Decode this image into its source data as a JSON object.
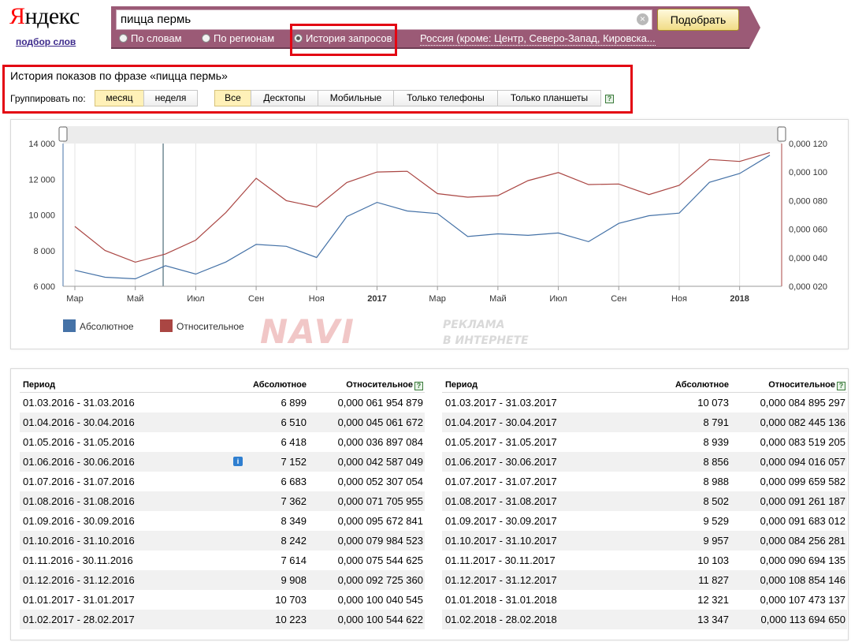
{
  "brand": {
    "logo_first": "Я",
    "logo_rest": "ндекс",
    "sublink": "подбор слов"
  },
  "search": {
    "value": "пицца пермь",
    "clear_glyph": "×",
    "submit_label": "Подобрать"
  },
  "modes": [
    {
      "label": "По словам",
      "selected": false
    },
    {
      "label": "По регионам",
      "selected": false
    },
    {
      "label": "История запросов",
      "selected": true
    }
  ],
  "region": "Россия (кроме: Центр, Северо-Запад, Кировска...",
  "history": {
    "title": "История показов по фразе «пицца пермь»",
    "group_label": "Группировать по:",
    "group_options": [
      {
        "label": "месяц",
        "active": true
      },
      {
        "label": "неделя",
        "active": false
      }
    ],
    "device_options": [
      {
        "label": "Все",
        "active": true
      },
      {
        "label": "Десктопы",
        "active": false
      },
      {
        "label": "Мобильные",
        "active": false
      },
      {
        "label": "Только телефоны",
        "active": false
      },
      {
        "label": "Только планшеты",
        "active": false
      }
    ],
    "help_glyph": "?"
  },
  "chart_data": {
    "type": "line",
    "x": [
      "2016-03",
      "2016-04",
      "2016-05",
      "2016-06",
      "2016-07",
      "2016-08",
      "2016-09",
      "2016-10",
      "2016-11",
      "2016-12",
      "2017-01",
      "2017-02",
      "2017-03",
      "2017-04",
      "2017-05",
      "2017-06",
      "2017-07",
      "2017-08",
      "2017-09",
      "2017-10",
      "2017-11",
      "2017-12",
      "2018-01",
      "2018-02"
    ],
    "x_tick_labels": [
      "Мар",
      "Май",
      "Июл",
      "Сен",
      "Ноя",
      "2017",
      "Мар",
      "Май",
      "Июл",
      "Сен",
      "Ноя",
      "2018"
    ],
    "series": [
      {
        "name": "Абсолютное",
        "axis": "left",
        "color": "#4572a7",
        "values": [
          6899,
          6510,
          6418,
          7152,
          6683,
          7362,
          8349,
          8242,
          7614,
          9908,
          10703,
          10223,
          10073,
          8791,
          8939,
          8856,
          8988,
          8502,
          9529,
          9957,
          10103,
          11827,
          12321,
          13347
        ]
      },
      {
        "name": "Относительное",
        "axis": "right",
        "color": "#aa4643",
        "values": [
          0.061954879,
          0.045061672,
          0.036897084,
          0.042587049,
          0.052307054,
          0.071705955,
          0.095672841,
          0.079984523,
          0.075544625,
          0.09272536,
          0.100040545,
          0.100544622,
          0.084895297,
          0.082445136,
          0.083519205,
          0.094016057,
          0.099659582,
          0.091261187,
          0.091683012,
          0.084256281,
          0.090694135,
          0.108854146,
          0.107473137,
          0.11369465
        ]
      }
    ],
    "y_left": {
      "ticks": [
        "6 000",
        "8 000",
        "10 000",
        "12 000",
        "14 000"
      ],
      "range": [
        6000,
        14000
      ]
    },
    "y_right": {
      "ticks": [
        "0,000 020",
        "0,000 040",
        "0,000 060",
        "0,000 080",
        "0,000 100",
        "0,000 120"
      ],
      "range": [
        0.02,
        0.12
      ]
    },
    "grid": true,
    "legend": "bottom-left"
  },
  "watermark": {
    "big": "NAVI",
    "line1": "РЕКЛАМА",
    "line2": "В ИНТЕРНЕТЕ"
  },
  "table": {
    "headers": {
      "period": "Период",
      "absolute": "Абсолютное",
      "relative": "Относительное"
    },
    "left": [
      {
        "period": "01.03.2016 - 31.03.2016",
        "abs": "6 899",
        "rel": "0,000 061 954 879"
      },
      {
        "period": "01.04.2016 - 30.04.2016",
        "abs": "6 510",
        "rel": "0,000 045 061 672"
      },
      {
        "period": "01.05.2016 - 31.05.2016",
        "abs": "6 418",
        "rel": "0,000 036 897 084"
      },
      {
        "period": "01.06.2016 - 30.06.2016",
        "abs": "7 152",
        "rel": "0,000 042 587 049",
        "info": "i"
      },
      {
        "period": "01.07.2016 - 31.07.2016",
        "abs": "6 683",
        "rel": "0,000 052 307 054"
      },
      {
        "period": "01.08.2016 - 31.08.2016",
        "abs": "7 362",
        "rel": "0,000 071 705 955"
      },
      {
        "period": "01.09.2016 - 30.09.2016",
        "abs": "8 349",
        "rel": "0,000 095 672 841"
      },
      {
        "period": "01.10.2016 - 31.10.2016",
        "abs": "8 242",
        "rel": "0,000 079 984 523"
      },
      {
        "period": "01.11.2016 - 30.11.2016",
        "abs": "7 614",
        "rel": "0,000 075 544 625"
      },
      {
        "period": "01.12.2016 - 31.12.2016",
        "abs": "9 908",
        "rel": "0,000 092 725 360"
      },
      {
        "period": "01.01.2017 - 31.01.2017",
        "abs": "10 703",
        "rel": "0,000 100 040 545"
      },
      {
        "period": "01.02.2017 - 28.02.2017",
        "abs": "10 223",
        "rel": "0,000 100 544 622"
      }
    ],
    "right": [
      {
        "period": "01.03.2017 - 31.03.2017",
        "abs": "10 073",
        "rel": "0,000 084 895 297"
      },
      {
        "period": "01.04.2017 - 30.04.2017",
        "abs": "8 791",
        "rel": "0,000 082 445 136"
      },
      {
        "period": "01.05.2017 - 31.05.2017",
        "abs": "8 939",
        "rel": "0,000 083 519 205"
      },
      {
        "period": "01.06.2017 - 30.06.2017",
        "abs": "8 856",
        "rel": "0,000 094 016 057"
      },
      {
        "period": "01.07.2017 - 31.07.2017",
        "abs": "8 988",
        "rel": "0,000 099 659 582"
      },
      {
        "period": "01.08.2017 - 31.08.2017",
        "abs": "8 502",
        "rel": "0,000 091 261 187"
      },
      {
        "period": "01.09.2017 - 30.09.2017",
        "abs": "9 529",
        "rel": "0,000 091 683 012"
      },
      {
        "period": "01.10.2017 - 31.10.2017",
        "abs": "9 957",
        "rel": "0,000 084 256 281"
      },
      {
        "period": "01.11.2017 - 30.11.2017",
        "abs": "10 103",
        "rel": "0,000 090 694 135"
      },
      {
        "period": "01.12.2017 - 31.12.2017",
        "abs": "11 827",
        "rel": "0,000 108 854 146"
      },
      {
        "period": "01.01.2018 - 31.01.2018",
        "abs": "12 321",
        "rel": "0,000 107 473 137"
      },
      {
        "period": "01.02.2018 - 28.02.2018",
        "abs": "13 347",
        "rel": "0,000 113 694 650"
      }
    ]
  }
}
